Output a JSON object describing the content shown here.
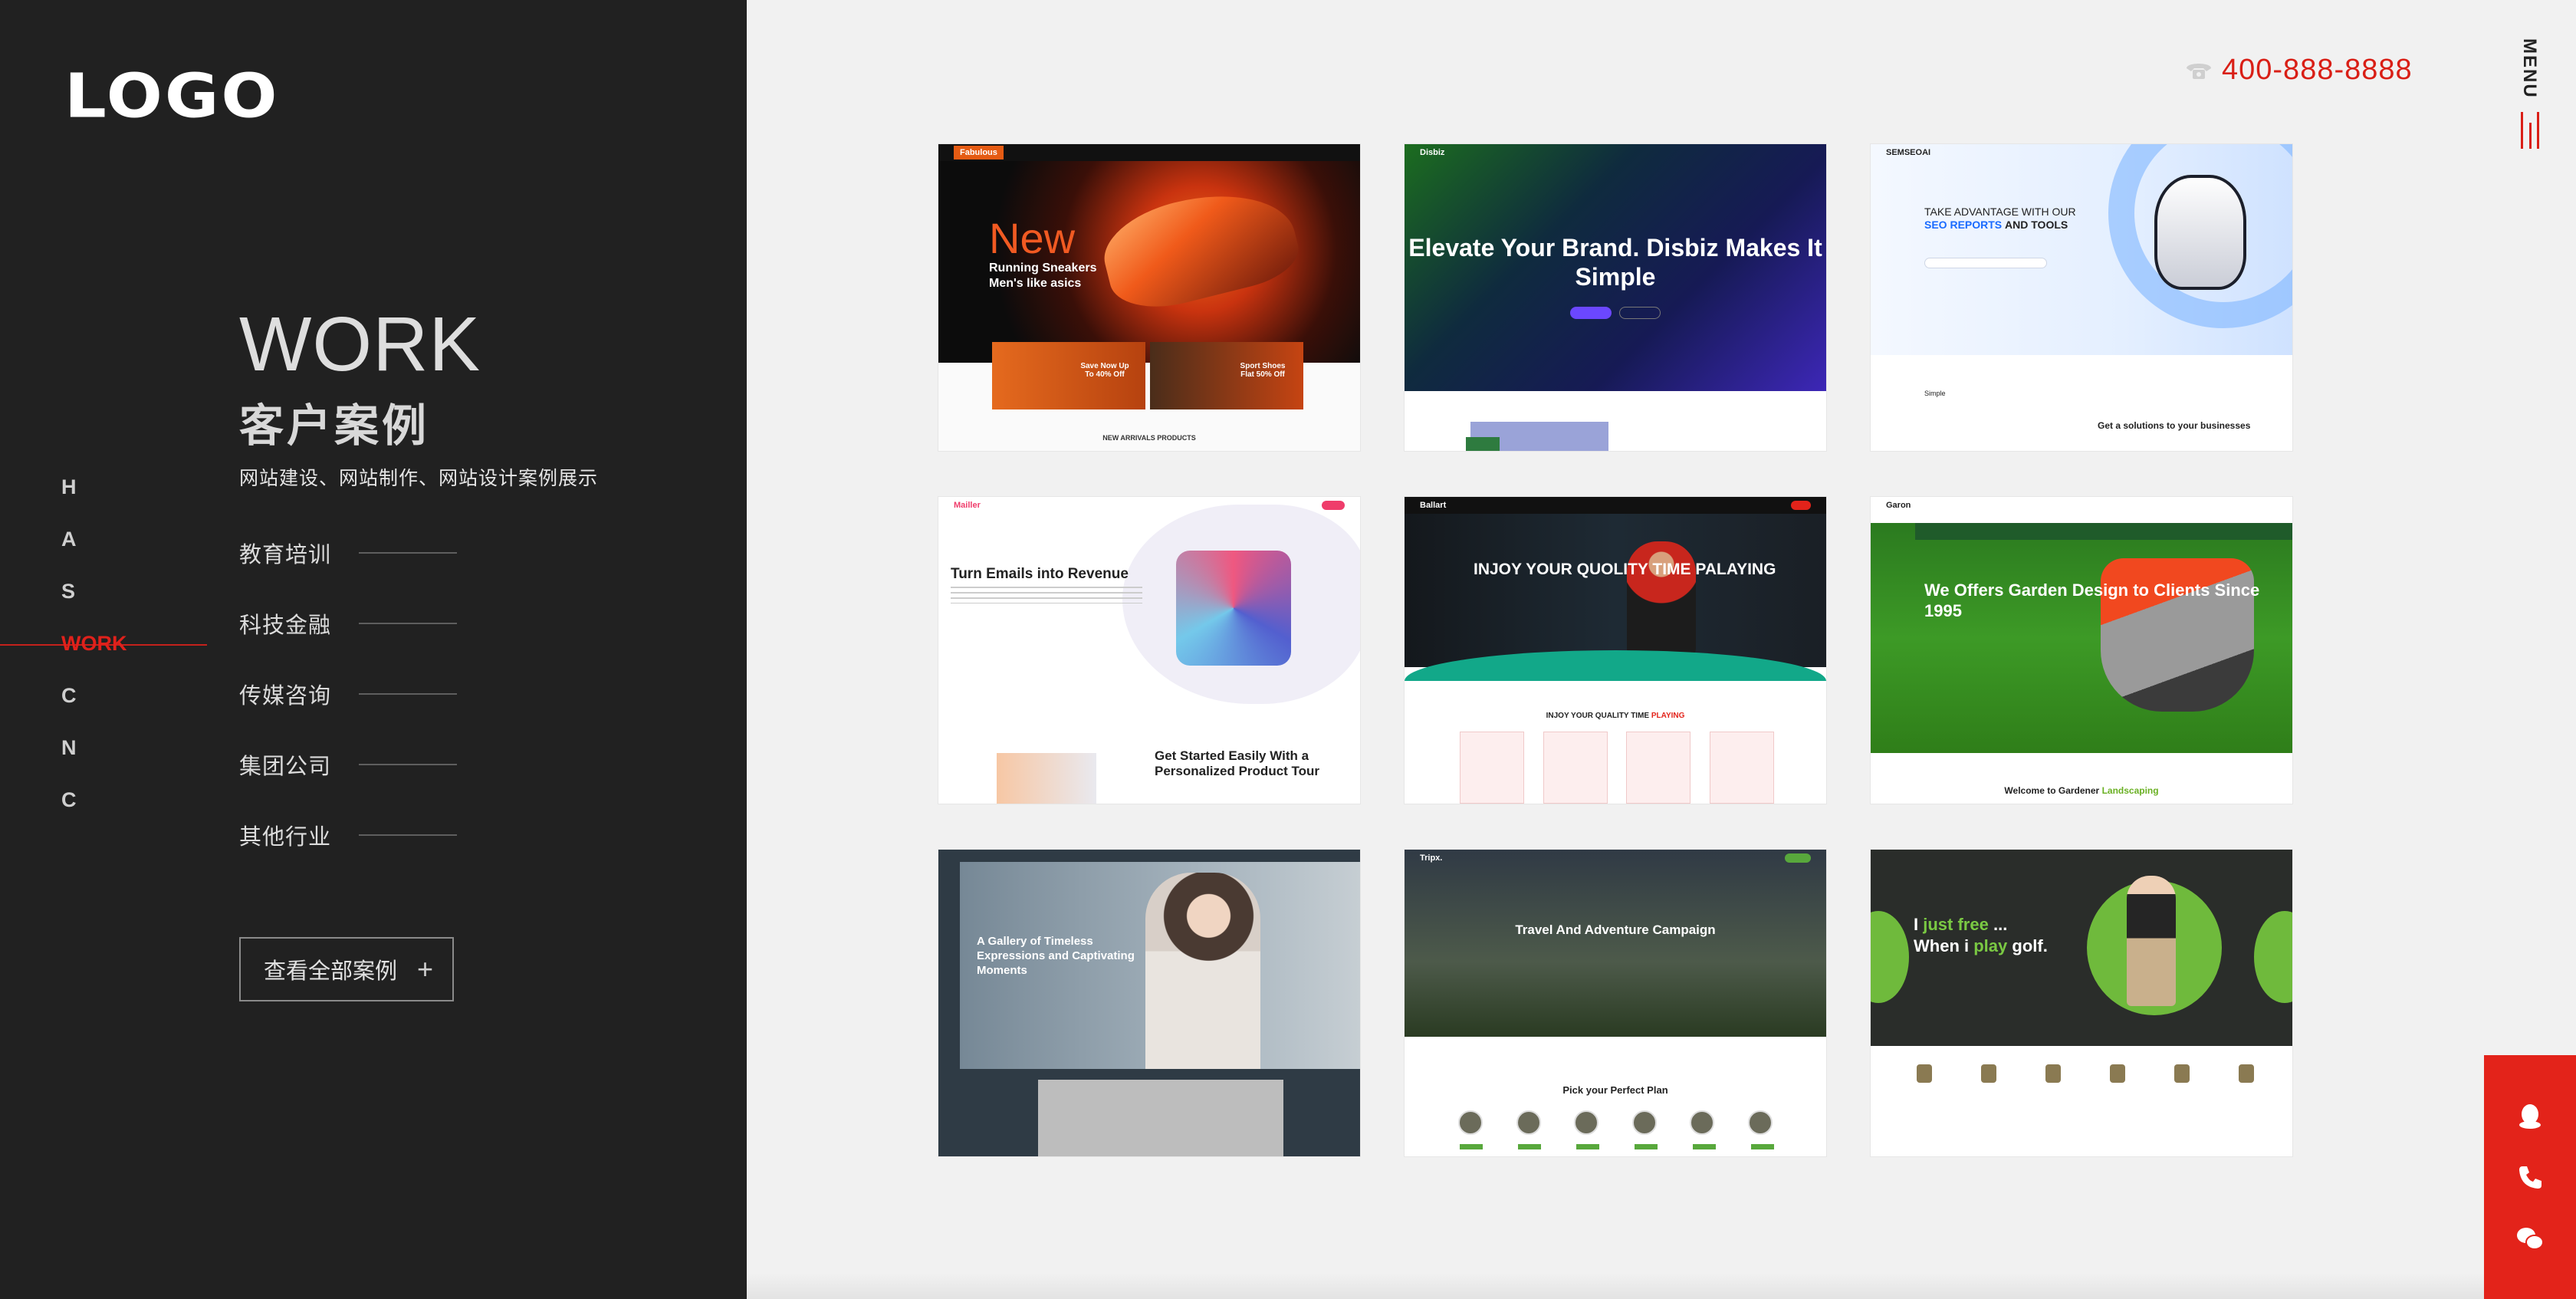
{
  "brand": {
    "logo": "LOGO"
  },
  "header": {
    "phone": "400-888-8888"
  },
  "menu": {
    "label": "MENU"
  },
  "dot_nav": [
    "H",
    "A",
    "S",
    "WORK",
    "C",
    "N",
    "C"
  ],
  "section": {
    "title_en": "WORK",
    "title_cn": "客户案例",
    "subtitle": "网站建设、网站制作、网站设计案例展示"
  },
  "categories": [
    "教育培训",
    "科技金融",
    "传媒咨询",
    "集团公司",
    "其他行业"
  ],
  "view_all": "查看全部案例",
  "cases": {
    "c1": {
      "brand": "Fabulous",
      "new": "New",
      "sub": "Running Sneakers Men's like asics",
      "promo1": "Save Now Up To 40% Off",
      "promo2": "Sport Shoes Flat 50% Off",
      "bottom": "NEW ARRIVALS PRODUCTS"
    },
    "c2": {
      "brand": "Disbiz",
      "headline": "Elevate Your Brand. Disbiz Makes It Simple"
    },
    "c3": {
      "brand": "SEMSEOAI",
      "line1": "TAKE ADVANTAGE WITH OUR",
      "line2": "SEO REPORTS",
      "line3": "AND TOOLS",
      "low": "Simple",
      "low2": "Get a solutions to your businesses"
    },
    "c4": {
      "brand": "Mailler",
      "headline": "Turn Emails into Revenue",
      "h2": "Get Started Easily With a Personalized Product Tour"
    },
    "c5": {
      "brand": "Ballart",
      "headline": "INJOY YOUR QUOLITY TIME PALAYING",
      "mid": "INJOY YOUR QUALITY TIME",
      "mid_accent": "PLAYING"
    },
    "c6": {
      "brand": "Garon",
      "headline": "We Offers Garden Design to Clients Since 1995",
      "welcome": "Welcome to Gardener",
      "welcome_accent": "Landscaping"
    },
    "c7": {
      "headline": "A Gallery of Timeless Expressions and Captivating Moments"
    },
    "c8": {
      "brand": "Tripx.",
      "headline": "Travel And Adventure Campaign",
      "plan": "Pick your Perfect Plan"
    },
    "c9": {
      "l1a": "I",
      "l1b": "just free",
      "l1c": "...",
      "l2a": "When i",
      "l2b": "play",
      "l2c": "golf."
    }
  },
  "colors": {
    "accent": "#e3231a",
    "dark_panel": "#212121",
    "page_bg": "#f1f1f1"
  },
  "icons": {
    "phone": "phone-icon",
    "qq": "qq-icon",
    "call": "call-icon",
    "wechat": "wechat-icon"
  }
}
